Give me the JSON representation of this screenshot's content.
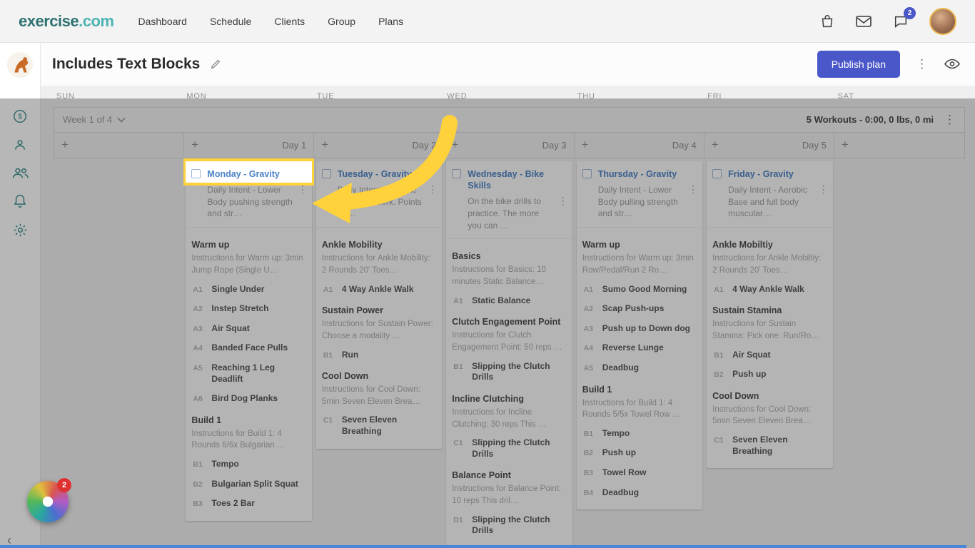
{
  "navbar": {
    "logo_primary": "exercise",
    "logo_secondary": ".com",
    "links": [
      "Dashboard",
      "Schedule",
      "Clients",
      "Group",
      "Plans"
    ],
    "chat_badge": "2"
  },
  "page_header": {
    "title": "Includes Text Blocks",
    "publish_button": "Publish plan"
  },
  "week_bar": {
    "week_label": "Week 1 of 4",
    "summary": "5 Workouts - 0:00, 0 lbs, 0 mi"
  },
  "calendar": {
    "day_headers": [
      "SUN",
      "MON",
      "TUE",
      "WED",
      "THU",
      "FRI",
      "SAT"
    ],
    "columns": [
      {
        "day_label": "",
        "card": null
      },
      {
        "day_label": "Day 1",
        "card": {
          "highlighted": true,
          "title": "Monday - Gravity",
          "description": "Daily Intent - Lower Body pushing strength and str…",
          "sections": [
            {
              "heading": "Warm up",
              "instructions": "Instructions for Warm up: 3min Jump Rope (Single U…",
              "exercises": [
                {
                  "code": "A1",
                  "name": "Single Under"
                },
                {
                  "code": "A2",
                  "name": "Instep Stretch"
                },
                {
                  "code": "A3",
                  "name": "Air Squat"
                },
                {
                  "code": "A4",
                  "name": "Banded Face Pulls"
                },
                {
                  "code": "A5",
                  "name": "Reaching 1 Leg Deadlift"
                },
                {
                  "code": "A6",
                  "name": "Bird Dog Planks"
                }
              ]
            },
            {
              "heading": "Build 1",
              "instructions": "Instructions for Build 1: 4 Rounds 6/6x Bulgarian …",
              "exercises": [
                {
                  "code": "B1",
                  "name": "Tempo"
                },
                {
                  "code": "B2",
                  "name": "Bulgarian Split Squat"
                },
                {
                  "code": "B3",
                  "name": "Toes 2 Bar"
                }
              ]
            }
          ]
        }
      },
      {
        "day_label": "Day 2",
        "card": {
          "highlighted": false,
          "title": "Tuesday - Gravity",
          "description": "Daily Intent - Aerobic threshold work. Points of …",
          "sections": [
            {
              "heading": "Ankle Mobility",
              "instructions": "Instructions for Ankle Mobility: 2 Rounds 20' Toes…",
              "exercises": [
                {
                  "code": "A1",
                  "name": "4 Way Ankle Walk"
                }
              ]
            },
            {
              "heading": "Sustain Power",
              "instructions": "Instructions for Sustain Power: Choose a modality …",
              "exercises": [
                {
                  "code": "B1",
                  "name": "Run"
                }
              ]
            },
            {
              "heading": "Cool Down",
              "instructions": "Instructions for Cool Down: 5min Seven Eleven Brea…",
              "exercises": [
                {
                  "code": "C1",
                  "name": "Seven Eleven Breathing"
                }
              ]
            }
          ]
        }
      },
      {
        "day_label": "Day 3",
        "card": {
          "highlighted": false,
          "title": "Wednesday - Bike Skills",
          "description": "On the bike drills to practice. The more you can …",
          "sections": [
            {
              "heading": "Basics",
              "instructions": "Instructions for Basics: 10 minutes Static Balance…",
              "exercises": [
                {
                  "code": "A1",
                  "name": "Static Balance"
                }
              ]
            },
            {
              "heading": "Clutch Engagement Point",
              "instructions": "Instructions for Clutch Engagement Point: 50 reps …",
              "exercises": [
                {
                  "code": "B1",
                  "name": "Slipping the Clutch Drills"
                }
              ]
            },
            {
              "heading": "Incline Clutching",
              "instructions": "Instructions for Incline Clutching: 30 reps This …",
              "exercises": [
                {
                  "code": "C1",
                  "name": "Slipping the Clutch Drills"
                }
              ]
            },
            {
              "heading": "Balance Point",
              "instructions": "Instructions for Balance Point: 10 reps This dril…",
              "exercises": [
                {
                  "code": "D1",
                  "name": "Slipping the Clutch Drills"
                }
              ]
            }
          ]
        }
      },
      {
        "day_label": "Day 4",
        "card": {
          "highlighted": false,
          "title": "Thursday - Gravity",
          "description": "Daily Intent - Lower Body pulling strength and str…",
          "sections": [
            {
              "heading": "Warm up",
              "instructions": "Instructions for Warm up: 3min Row/Pedal/Run 2 Ro…",
              "exercises": [
                {
                  "code": "A1",
                  "name": "Sumo Good Morning"
                },
                {
                  "code": "A2",
                  "name": "Scap Push-ups"
                },
                {
                  "code": "A3",
                  "name": "Push up to Down dog"
                },
                {
                  "code": "A4",
                  "name": "Reverse Lunge"
                },
                {
                  "code": "A5",
                  "name": "Deadbug"
                }
              ]
            },
            {
              "heading": "Build 1",
              "instructions": "Instructions for Build 1: 4 Rounds 5/5x Towel Row …",
              "exercises": [
                {
                  "code": "B1",
                  "name": "Tempo"
                },
                {
                  "code": "B2",
                  "name": "Push up"
                },
                {
                  "code": "B3",
                  "name": "Towel Row"
                },
                {
                  "code": "B4",
                  "name": "Deadbug"
                }
              ]
            }
          ]
        }
      },
      {
        "day_label": "Day 5",
        "card": {
          "highlighted": false,
          "title": "Friday - Gravity",
          "description": "Daily Intent - Aerobic Base and full body muscular…",
          "sections": [
            {
              "heading": "Ankle Mobiltiy",
              "instructions": "Instructions for Ankle Mobiltiy: 2 Rounds 20' Toes…",
              "exercises": [
                {
                  "code": "A1",
                  "name": "4 Way Ankle Walk"
                }
              ]
            },
            {
              "heading": "Sustain Stamina",
              "instructions": "Instructions for Sustain Stamina: Pick one: Run/Ro…",
              "exercises": [
                {
                  "code": "B1",
                  "name": "Air Squat"
                },
                {
                  "code": "B2",
                  "name": "Push up"
                }
              ]
            },
            {
              "heading": "Cool Down",
              "instructions": "Instructions for Cool Down: 5min Seven Eleven Brea…",
              "exercises": [
                {
                  "code": "C1",
                  "name": "Seven Eleven Breathing"
                }
              ]
            }
          ]
        }
      },
      {
        "day_label": "",
        "card": null
      }
    ]
  },
  "chat_widget": {
    "badge": "2"
  },
  "colors": {
    "accent_indigo": "#4a57c9",
    "brand_teal": "#2e7273",
    "brand_teal_light": "#4db3b3",
    "highlight_yellow": "#ffd23b",
    "card_title_blue": "#4b82c4",
    "badge_red": "#e03131"
  }
}
